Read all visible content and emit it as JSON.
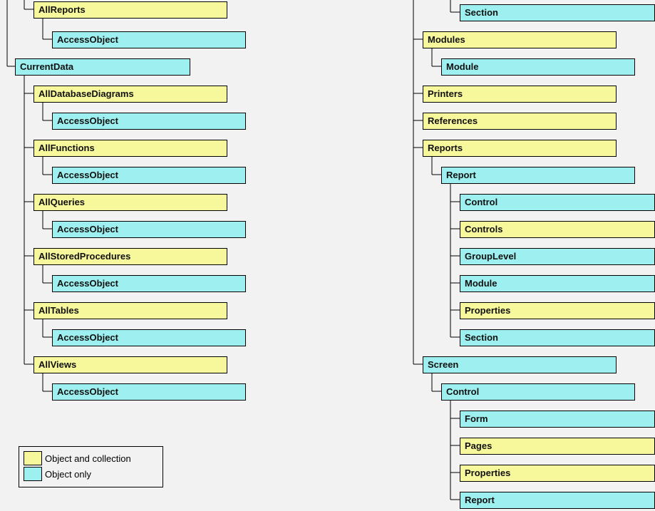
{
  "legend": {
    "object_and_collection": "Object and collection",
    "object_only": "Object only"
  },
  "left": {
    "all_reports": "AllReports",
    "all_reports_child": "AccessObject",
    "current_data": "CurrentData",
    "all_database_diagrams": "AllDatabaseDiagrams",
    "all_database_diagrams_child": "AccessObject",
    "all_functions": "AllFunctions",
    "all_functions_child": "AccessObject",
    "all_queries": "AllQueries",
    "all_queries_child": "AccessObject",
    "all_stored_procedures": "AllStoredProcedures",
    "all_stored_procedures_child": "AccessObject",
    "all_tables": "AllTables",
    "all_tables_child": "AccessObject",
    "all_views": "AllViews",
    "all_views_child": "AccessObject"
  },
  "right": {
    "section_top": "Section",
    "modules": "Modules",
    "modules_module": "Module",
    "printers": "Printers",
    "references": "References",
    "reports": "Reports",
    "reports_report": "Report",
    "reports_control": "Control",
    "reports_controls": "Controls",
    "reports_grouplevel": "GroupLevel",
    "reports_module": "Module",
    "reports_properties": "Properties",
    "reports_section": "Section",
    "screen": "Screen",
    "screen_control": "Control",
    "screen_form": "Form",
    "screen_pages": "Pages",
    "screen_properties": "Properties",
    "screen_report": "Report"
  }
}
